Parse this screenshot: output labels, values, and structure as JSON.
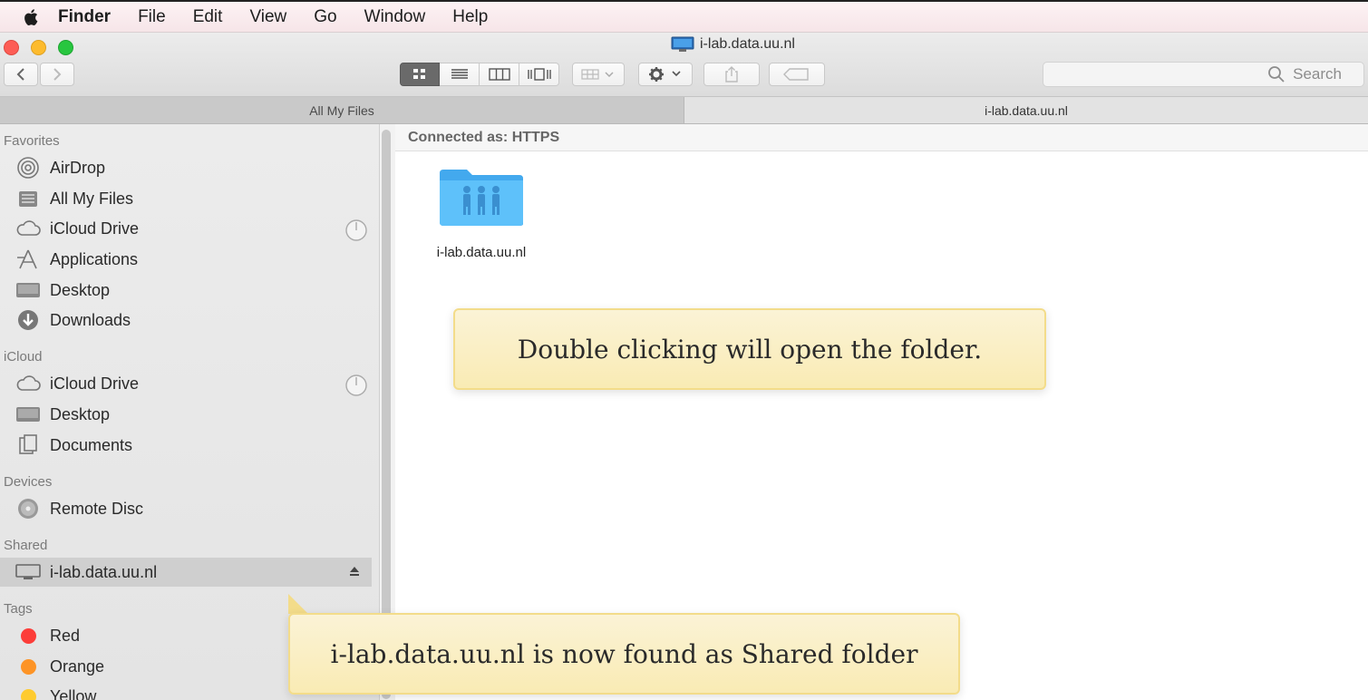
{
  "menubar": {
    "app": "Finder",
    "items": [
      "File",
      "Edit",
      "View",
      "Go",
      "Window",
      "Help"
    ]
  },
  "window": {
    "title": "i-lab.data.uu.nl",
    "search_placeholder": "Search"
  },
  "tabs": [
    {
      "label": "All My Files",
      "active": false
    },
    {
      "label": "i-lab.data.uu.nl",
      "active": true
    }
  ],
  "sidebar": {
    "favorites_header": "Favorites",
    "favorites": [
      {
        "label": "AirDrop",
        "icon": "airdrop-icon"
      },
      {
        "label": "All My Files",
        "icon": "all-files-icon"
      },
      {
        "label": "iCloud Drive",
        "icon": "cloud-icon"
      },
      {
        "label": "Applications",
        "icon": "applications-icon"
      },
      {
        "label": "Desktop",
        "icon": "desktop-icon"
      },
      {
        "label": "Downloads",
        "icon": "download-icon"
      }
    ],
    "icloud_header": "iCloud",
    "icloud": [
      {
        "label": "iCloud Drive",
        "icon": "cloud-icon"
      },
      {
        "label": "Desktop",
        "icon": "desktop-icon"
      },
      {
        "label": "Documents",
        "icon": "documents-icon"
      }
    ],
    "devices_header": "Devices",
    "devices": [
      {
        "label": "Remote Disc",
        "icon": "disc-icon"
      }
    ],
    "shared_header": "Shared",
    "shared": [
      {
        "label": "i-lab.data.uu.nl",
        "icon": "server-icon",
        "selected": true
      }
    ],
    "tags_header": "Tags",
    "tags": [
      {
        "label": "Red",
        "color": "#fc3d39"
      },
      {
        "label": "Orange",
        "color": "#fd9426"
      },
      {
        "label": "Yellow",
        "color": "#fecb2f"
      }
    ]
  },
  "main": {
    "connected_text": "Connected as: HTTPS",
    "file_name": "i-lab.data.uu.nl"
  },
  "callouts": {
    "top": "Double clicking will open the folder.",
    "bottom": "i-lab.data.uu.nl is now found as Shared folder"
  }
}
